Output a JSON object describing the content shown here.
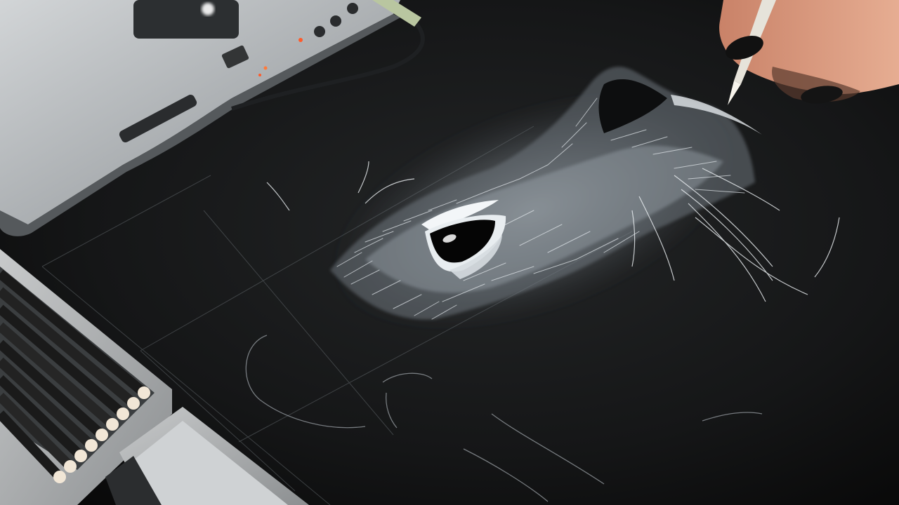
{
  "scene": {
    "colors": {
      "paper": "#141516",
      "laptop": "#b9bcbe",
      "chalk": "#e8ecef",
      "nail_polish": "#111111",
      "skin": "#d89a80",
      "led": "#ff5a2a"
    }
  }
}
